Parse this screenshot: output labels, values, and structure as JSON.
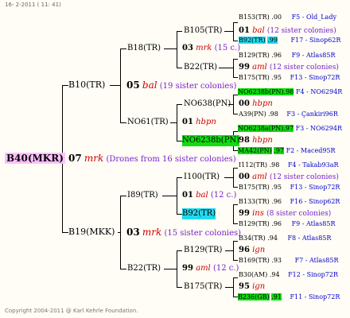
{
  "header": {
    "text": "16-  2-2011 ( 11: 41)"
  },
  "footer": {
    "text": "Copyright 2004-2011 @ Karl Kehrle Foundation."
  },
  "tree": {
    "root": "B40(MKR)",
    "g1": {
      "num": "07",
      "race": "mrk",
      "note": "(Drones from 16 sister colonies)"
    },
    "top": {
      "node": "B10(TR)",
      "mid": {
        "num": "05",
        "race": "bal",
        "note": "(19 sister colonies)"
      },
      "a": {
        "node": "B18(TR)",
        "mid": {
          "num": "03",
          "race": "mrk",
          "note": "(15 c.)"
        },
        "a": {
          "node": "B105(TR)",
          "mid": {
            "num": "01",
            "race": "bal",
            "note": "(12 sister colonies)"
          },
          "l1": {
            "name": "B153(TR)",
            "score": ".00",
            "ref": "F5 - Old_Lady"
          },
          "l2": {
            "name": "B92(TR)",
            "score": ".99",
            "ref": "F17 - Sinop62R"
          }
        },
        "b": {
          "node": "B22(TR)",
          "mid": {
            "num": "99",
            "race": "aml",
            "note": "(12 sister colonies)"
          },
          "l1": {
            "name": "B129(TR)",
            "score": ".96",
            "ref": "F9 - Atlas85R"
          },
          "l2": {
            "name": "B175(TR)",
            "score": ".95",
            "ref": "F13 - Sinop72R"
          }
        }
      },
      "b": {
        "node": "NO61(TR)",
        "mid": {
          "num": "01",
          "race": "hbpn"
        },
        "a": {
          "node": "NO638(PN)",
          "mid": {
            "num": "00",
            "race": "hbpn"
          },
          "l1": {
            "name": "NO6238b(PN)",
            "score": ".98",
            "ref": "F4 - NO6294R"
          },
          "l2": {
            "name": "A39(PN)",
            "score": ".98",
            "ref": "F3 - Çankiri96R"
          }
        },
        "b": {
          "node": "NO6238b(PN)",
          "mid": {
            "num": "98",
            "race": "hbpn"
          },
          "l1": {
            "name": "NO6238a(PN)",
            "score": ".97",
            "ref": "F3 - NO6294R"
          },
          "l2": {
            "name": "MA42(PN)",
            "score": ".97",
            "ref": "F2 - Maced95R"
          }
        }
      }
    },
    "bottom": {
      "node": "B19(MKK)",
      "mid": {
        "num": "03",
        "race": "mrk",
        "note": "(15 sister colonies)"
      },
      "a": {
        "node": "I89(TR)",
        "mid": {
          "num": "01",
          "race": "bal",
          "note": "(12 c.)"
        },
        "a": {
          "node": "I100(TR)",
          "mid": {
            "num": "00",
            "race": "aml",
            "note": "(12 sister colonies)"
          },
          "l1": {
            "name": "I112(TR)",
            "score": ".98",
            "ref": "F4 - Takab93aR"
          },
          "l2": {
            "name": "B175(TR)",
            "score": ".95",
            "ref": "F13 - Sinop72R"
          }
        },
        "b": {
          "node": "B92(TR)",
          "mid": {
            "num": "99",
            "race": "ins",
            "note": "(8 sister colonies)"
          },
          "l1": {
            "name": "B133(TR)",
            "score": ".96",
            "ref": "F16 - Sinop62R"
          },
          "l2": {
            "name": "B129(TR)",
            "score": ".96",
            "ref": "F9 - Atlas85R"
          }
        }
      },
      "b": {
        "node": "B22(TR)",
        "mid": {
          "num": "99",
          "race": "aml",
          "note": "(12 c.)"
        },
        "a": {
          "node": "B129(TR)",
          "mid": {
            "num": "96",
            "race": "ign"
          },
          "l1": {
            "name": "B34(TR)",
            "score": ".94",
            "ref": "F8 - Atlas85R"
          },
          "l2": {
            "name": "B169(TR)",
            "score": ".93",
            "ref": "F7 - Atlas85R"
          }
        },
        "b": {
          "node": "B175(TR)",
          "mid": {
            "num": "95",
            "race": "ign"
          },
          "l1": {
            "name": "B30(AM)",
            "score": ".94",
            "ref": "F12 - Sinop72R"
          },
          "l2": {
            "name": "B236(GB)",
            "score": ".91",
            "ref": "F11 - Sinop72R"
          }
        }
      }
    }
  }
}
